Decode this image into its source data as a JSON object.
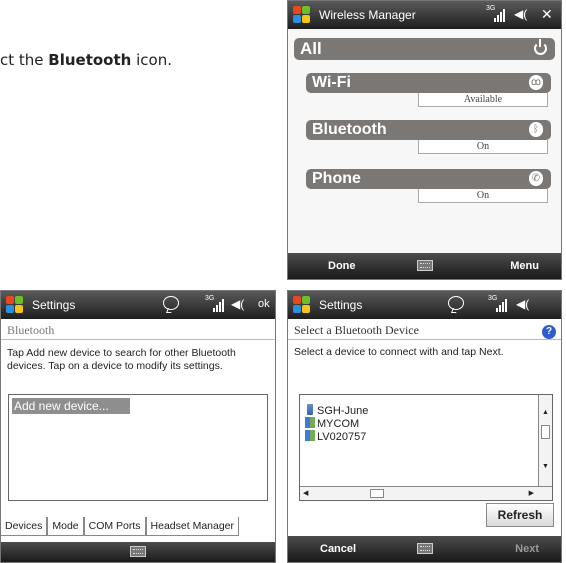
{
  "instruction": {
    "prefix": "ct the ",
    "bold": "Bluetooth",
    "suffix": " icon."
  },
  "wireless_manager": {
    "title": "Wireless Manager",
    "network": "3G",
    "all_label": "All",
    "rows": [
      {
        "label": "Wi-Fi",
        "status": "Available",
        "icon": "wifi-icon"
      },
      {
        "label": "Bluetooth",
        "status": "On",
        "icon": "bluetooth-icon"
      },
      {
        "label": "Phone",
        "status": "On",
        "icon": "phone-icon"
      }
    ],
    "left_softkey": "Done",
    "right_softkey": "Menu"
  },
  "bt_settings": {
    "title": "Settings",
    "network": "3G",
    "ok": "ok",
    "subheader": "Bluetooth",
    "description": "Tap Add new device to search for other Bluetooth devices. Tap on a device to modify its settings.",
    "add_new": "Add new device...",
    "tabs": [
      "Devices",
      "Mode",
      "COM Ports",
      "Headset Manager"
    ]
  },
  "select_device": {
    "title": "Settings",
    "network": "3G",
    "subheader": "Select a Bluetooth Device",
    "help": "?",
    "instruction": "Select a device to connect with and tap Next.",
    "devices": [
      {
        "name": "SGH-June",
        "icon": "phone-device-icon"
      },
      {
        "name": "MYCOM",
        "icon": "computer-icon"
      },
      {
        "name": "LV020757",
        "icon": "computer-icon"
      }
    ],
    "refresh": "Refresh",
    "left_softkey": "Cancel",
    "right_softkey": "Next"
  }
}
